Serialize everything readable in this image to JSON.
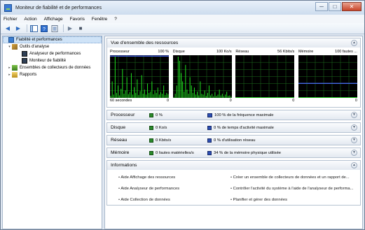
{
  "window": {
    "title": "Moniteur de fiabilité et de performances",
    "min": "─",
    "max": "□",
    "close": "✕"
  },
  "menu": [
    "Fichier",
    "Action",
    "Affichage",
    "Favoris",
    "Fenêtre",
    "?"
  ],
  "toolbar": {
    "back": "◀",
    "forward": "▶",
    "play": "▶",
    "stop": "■"
  },
  "tree": [
    {
      "label": "Fiabilité et performances",
      "indent": 0,
      "icon": "perf",
      "twisty": "",
      "selected": true
    },
    {
      "label": "Outils d'analyse",
      "indent": 1,
      "icon": "tools",
      "twisty": "▾"
    },
    {
      "label": "Analyseur de performances",
      "indent": 2,
      "icon": "mon",
      "twisty": ""
    },
    {
      "label": "Moniteur de fiabilité",
      "indent": 2,
      "icon": "mon",
      "twisty": ""
    },
    {
      "label": "Ensembles de collecteurs de données",
      "indent": 1,
      "icon": "set",
      "twisty": "▸"
    },
    {
      "label": "Rapports",
      "indent": 1,
      "icon": "rep",
      "twisty": "▸"
    }
  ],
  "overview": {
    "title": "Vue d'ensemble des ressources",
    "graphs": [
      {
        "name": "Processeur",
        "max": "100 %",
        "foot_left": "60 secondes",
        "foot_right": "0",
        "peak": 100
      },
      {
        "name": "Disque",
        "max": "100 Ko/s",
        "foot_left": "",
        "foot_right": "0",
        "peak": 100
      },
      {
        "name": "Réseau",
        "max": "56 Kbits/s",
        "foot_left": "",
        "foot_right": "0",
        "peak": 0
      },
      {
        "name": "Mémoire",
        "max": "100 fautes ...",
        "foot_left": "",
        "foot_right": "0",
        "peak": 0
      }
    ]
  },
  "sections": [
    {
      "title": "Processeur",
      "m1": "0 %",
      "m2": "100 % de la fréquence maximale"
    },
    {
      "title": "Disque",
      "m1": "0 Ko/s",
      "m2": "0 % de temps d'activité maximale"
    },
    {
      "title": "Réseau",
      "m1": "0 Kbits/s",
      "m2": "0 % d'utilisation réseau"
    },
    {
      "title": "Mémoire",
      "m1": "0 fautes matérielles/s",
      "m2": "34 % de la mémoire physique utilisée"
    }
  ],
  "info": {
    "title": "Informations",
    "links": [
      "Aide Affichage des ressources",
      "Créer un ensemble de collecteurs de données et un rapport de...",
      "Aide Analyseur de performances",
      "Contrôler l'activité du système à l'aide de l'analyseur de performa...",
      "Aide Collection de données",
      "Planifier et gérer des données"
    ]
  },
  "colors": {
    "graph_bg": "#000000",
    "grid": "#1f6f1f",
    "line_green": "#20e020",
    "line_blue": "#4a6cff"
  },
  "series": {
    "cpu": [
      5,
      40,
      8,
      100,
      12,
      30,
      6,
      22,
      70,
      10,
      18,
      50,
      9,
      14,
      60,
      8,
      26,
      12,
      45,
      7,
      16,
      55,
      10,
      20,
      8,
      35,
      12,
      15,
      40,
      9,
      18,
      12,
      25,
      8,
      14,
      10,
      30,
      7,
      12,
      9
    ],
    "disk": [
      2,
      10,
      30,
      100,
      90,
      60,
      40,
      15,
      80,
      20,
      10,
      50,
      30,
      12,
      25,
      8,
      15,
      6,
      40,
      10,
      8,
      18,
      5,
      12,
      30,
      6,
      10,
      4,
      14,
      5,
      8,
      20,
      6,
      10,
      4,
      8,
      15,
      5,
      6,
      3
    ],
    "memory_level": 34
  }
}
